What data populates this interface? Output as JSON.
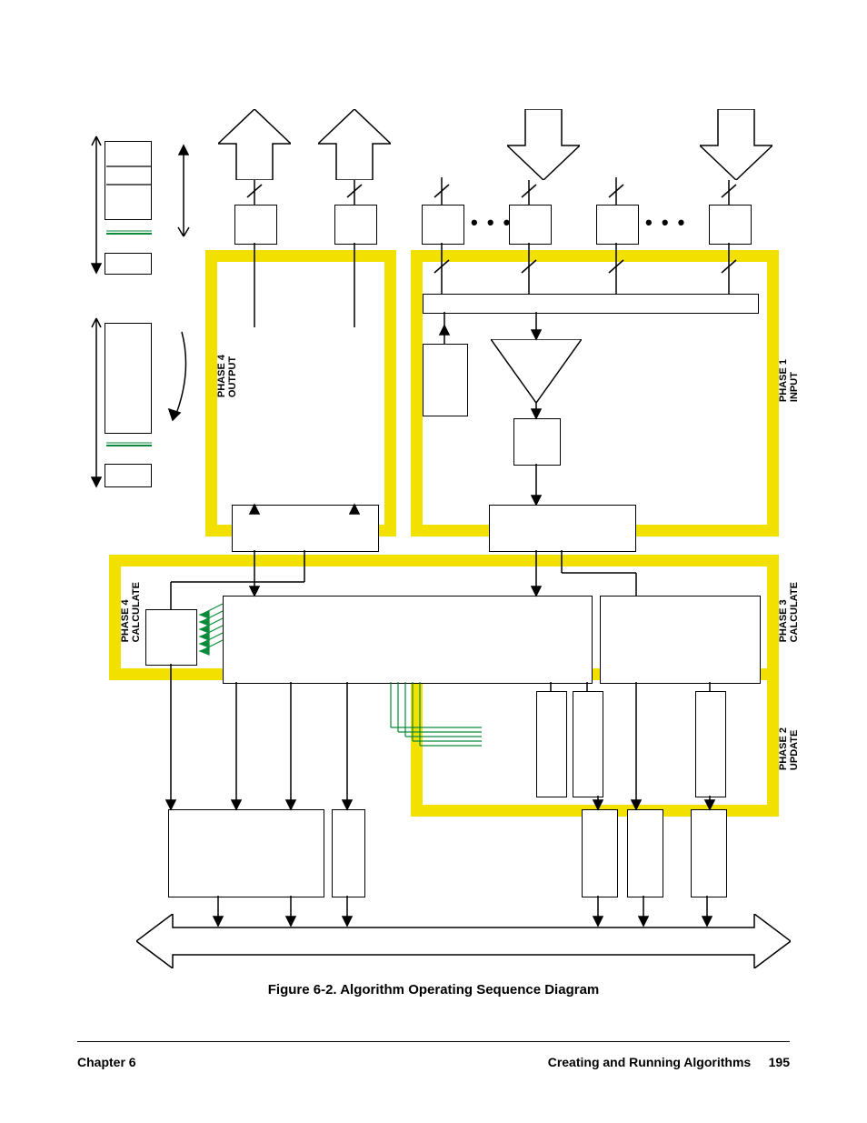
{
  "caption": "Figure 6-2. Algorithm Operating Sequence Diagram",
  "footer": {
    "left": "Chapter 6",
    "right_title": "Creating and Running Algorithms",
    "page": "195"
  },
  "phases": {
    "p1": "PHASE 1\nINPUT",
    "p2": "PHASE 2\nUPDATE",
    "p3": "PHASE 3\nCALCULATE",
    "p4out": "PHASE 4\nOUTPUT",
    "p4calc": "PHASE 4\nCALCULATE"
  },
  "ellipsis": "• • •"
}
